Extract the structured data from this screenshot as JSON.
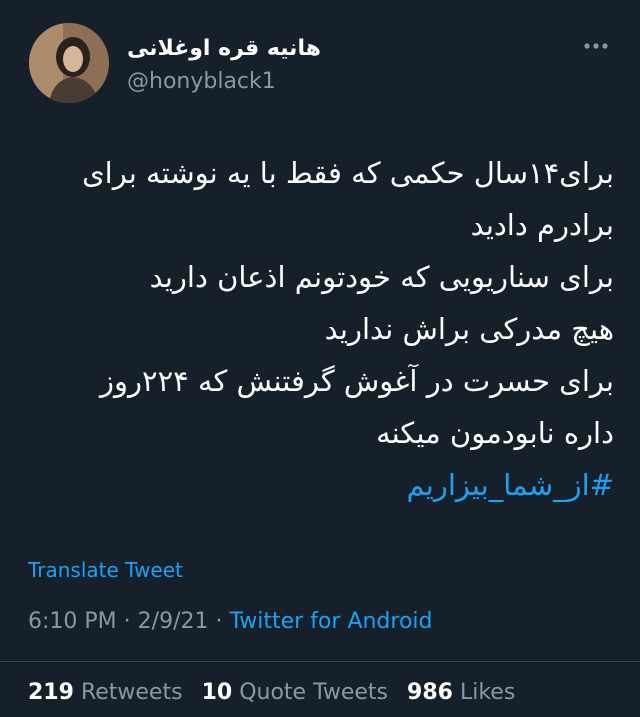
{
  "author": {
    "display_name": "هانیه قره اوغلانی",
    "handle": "@honyblack1"
  },
  "tweet": {
    "lines": [
      "برای۱۴سال حکمی که فقط با یه نوشته برای",
      "برادرم دادید",
      "برای سناریویی که خودتونم اذعان دارید",
      "هیچ مدرکی براش ندارید",
      "برای حسرت در آغوش گرفتنش که ۲۲۴روز",
      "داره نابودمون میکنه"
    ],
    "hashtag": "#از_شما_بیزاریم"
  },
  "translate_label": "Translate Tweet",
  "meta": {
    "time": "6:10 PM",
    "date": "2/9/21",
    "separator": "·",
    "source": "Twitter for Android"
  },
  "stats": {
    "retweets_count": "219",
    "retweets_label": "Retweets",
    "quotes_count": "10",
    "quotes_label": "Quote Tweets",
    "likes_count": "986",
    "likes_label": "Likes"
  },
  "colors": {
    "background": "#15202b",
    "accent": "#1da1f2",
    "secondary_text": "#8899a6",
    "divider": "#38444d"
  },
  "icons": {
    "more": "more-horizontal-icon"
  }
}
